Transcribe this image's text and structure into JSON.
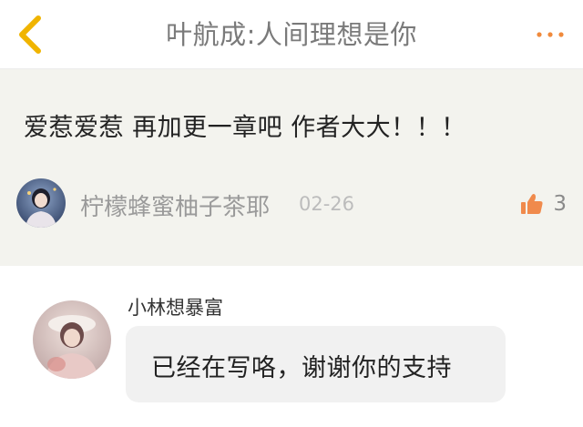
{
  "header": {
    "title": "叶航成:人间理想是你",
    "back_icon": "chevron-left-icon",
    "more_icon": "more-dots-icon",
    "accent_color": "#f0b400",
    "more_color": "#f08a3c"
  },
  "comment": {
    "text": "爱惹爱惹 再加更一章吧 作者大大！！！",
    "author": "柠檬蜂蜜柚子茶耶",
    "date": "02-26",
    "like_icon": "thumbs-up-icon",
    "like_count": "3",
    "like_color": "#f08a4c",
    "background": "#f3f3ee"
  },
  "reply": {
    "author": "小林想暴富",
    "text": "已经在写咯，谢谢你的支持",
    "bubble_color": "#f1f1f1"
  }
}
